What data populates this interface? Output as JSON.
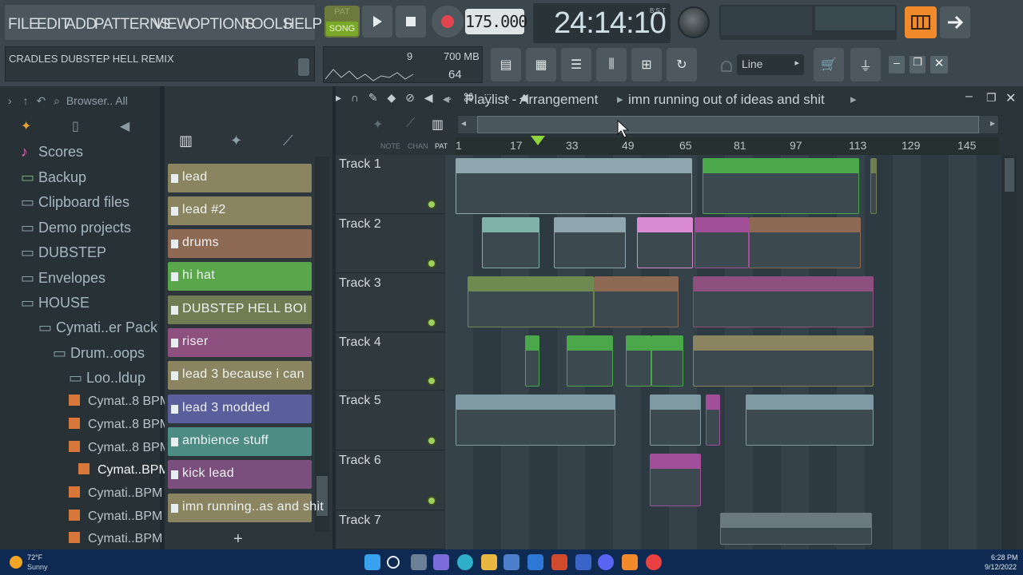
{
  "menu": {
    "items": [
      "FILE",
      "EDIT",
      "ADD",
      "PATTERNS",
      "VIEW",
      "OPTIONS",
      "TOOLS",
      "HELP"
    ]
  },
  "song": {
    "title": "CRADLES DUBSTEP HELL REMIX"
  },
  "transport": {
    "pat_label": "PAT",
    "song_label": "SONG",
    "tempo": "175.000",
    "time": "24:14:10",
    "time_mode": "B:S:T"
  },
  "cpu": {
    "voices": "9",
    "memory": "700 MB",
    "cpu_value": "64"
  },
  "snap": {
    "value": "Line"
  },
  "browser": {
    "header": "Browser.. All",
    "items": [
      "Scores",
      "Backup",
      "Clipboard files",
      "Demo projects",
      "DUBSTEP",
      "Envelopes",
      "HOUSE",
      "Cymati..er Pack",
      "Drum..oops",
      "Loo..ldup"
    ],
    "files": [
      "Cymat..8 BPM",
      "Cymat..8 BPM",
      "Cymat..8 BPM",
      "Cymat..BPM",
      "Cymati..BPM",
      "Cymati..BPM",
      "Cymati..BPM"
    ]
  },
  "patterns": [
    {
      "label": "lead",
      "color": "#8a8560"
    },
    {
      "label": "lead #2",
      "color": "#8a8560"
    },
    {
      "label": "drums",
      "color": "#8e6a55"
    },
    {
      "label": "hi hat",
      "color": "#5aa64a"
    },
    {
      "label": "DUBSTEP  HELL  BOI",
      "color": "#6f7e52"
    },
    {
      "label": "riser",
      "color": "#8d4f7d"
    },
    {
      "label": "lead 3 because i can",
      "color": "#8a8560"
    },
    {
      "label": "lead 3 modded",
      "color": "#5a5f9c"
    },
    {
      "label": "ambience stuff",
      "color": "#4d8c85"
    },
    {
      "label": "kick lead",
      "color": "#7a4f7d"
    },
    {
      "label": "imn running..as and shit",
      "color": "#8a8560"
    }
  ],
  "playlist": {
    "title": "Playlist - Arrangement",
    "pattern": "imn running out of ideas and shit",
    "view_labels": [
      "NOTE",
      "CHAN",
      "PAT"
    ],
    "ruler": [
      "1",
      "17",
      "33",
      "49",
      "65",
      "81",
      "97",
      "113",
      "129",
      "145"
    ],
    "tracks": [
      "Track 1",
      "Track 2",
      "Track 3",
      "Track 4",
      "Track 5",
      "Track 6",
      "Track 7"
    ]
  },
  "taskbar": {
    "temp": "72°F",
    "weather": "Sunny",
    "clock": "6:28 PM",
    "date": "9/12/2022"
  }
}
